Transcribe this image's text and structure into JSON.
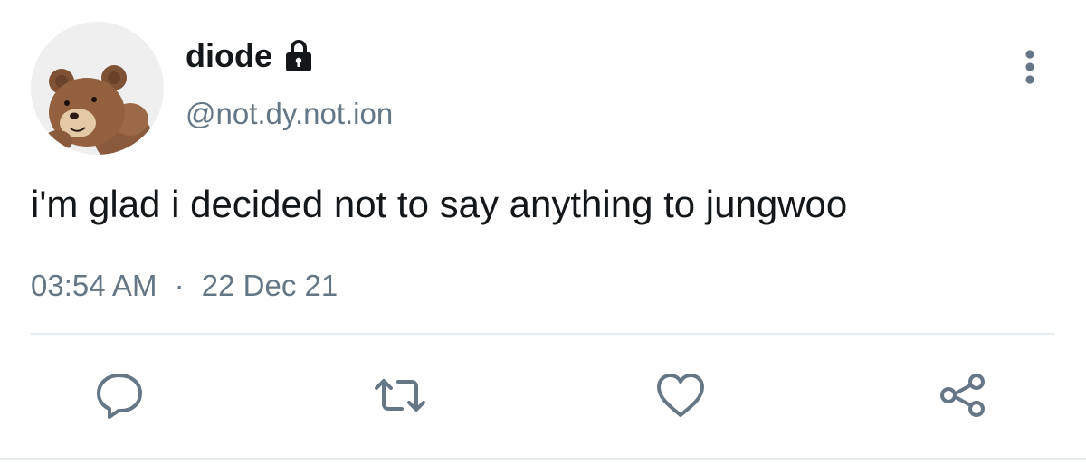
{
  "user": {
    "display_name": "diode",
    "handle": "@not.dy.not.ion",
    "protected": true,
    "avatar": "teddy-bear-photo"
  },
  "tweet": {
    "text": "i'm glad i decided not to say anything to jungwoo",
    "time": "03:54 AM",
    "separator": "·",
    "date": "22 Dec 21"
  },
  "actions": [
    {
      "name": "reply",
      "icon": "speech-bubble-icon"
    },
    {
      "name": "retweet",
      "icon": "retweet-arrows-icon"
    },
    {
      "name": "like",
      "icon": "heart-outline-icon"
    },
    {
      "name": "share",
      "icon": "share-nodes-icon"
    }
  ],
  "colors": {
    "text": "#14171a",
    "secondary": "#657786",
    "divider": "#e6ecf0",
    "icon": "#657786"
  }
}
